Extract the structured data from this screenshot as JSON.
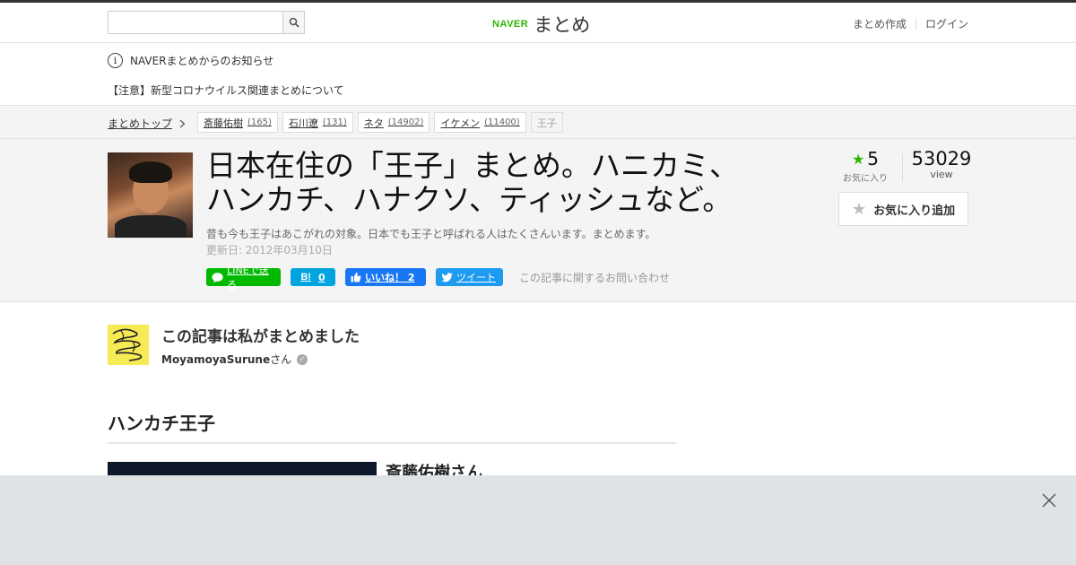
{
  "search": {
    "placeholder": ""
  },
  "logo": {
    "brand": "NAVER",
    "name": "まとめ"
  },
  "header": {
    "create_label": "まとめ作成",
    "login_label": "ログイン"
  },
  "notice": {
    "info_label": "NAVERまとめからのお知らせ",
    "message": "【注意】新型コロナウイルス関連まとめについて"
  },
  "breadcrumb": {
    "home_label": "まとめトップ",
    "tags": [
      {
        "label": "斎藤佑樹",
        "count": "(165)"
      },
      {
        "label": "石川遼",
        "count": "(131)"
      },
      {
        "label": "ネタ",
        "count": "(14902)"
      },
      {
        "label": "イケメン",
        "count": "(11400)"
      },
      {
        "label": "王子",
        "count": ""
      }
    ]
  },
  "article": {
    "title_line1": "日本在住の「王子」まとめ。ハニカミ、",
    "title_line2": "ハンカチ、ハナクソ、ティッシュなど。",
    "description": "昔も今も王子はあこがれの対象。日本でも王子と呼ばれる人はたくさんいます。まとめます。",
    "updated": "更新日: 2012年03月10日"
  },
  "share": {
    "line_label": "LINEで送る",
    "hatena_count": "0",
    "fb_label": "いいね！ 2",
    "tw_label": "ツイート",
    "inquiry_label": "この記事に関するお問い合わせ"
  },
  "stats": {
    "favorites": "5",
    "favorites_label": "お気に入り",
    "views": "53029",
    "views_label": "view",
    "fav_add_label": "お気に入り追加"
  },
  "author": {
    "heading": "この記事は私がまとめました",
    "name": "MoyamoyaSurune",
    "suffix": "さん"
  },
  "section": {
    "title": "ハンカチ王子",
    "first_item_title": "斎藤佑樹さん"
  },
  "colors": {
    "brand_green": "#2db400",
    "line_green": "#00b900",
    "hatena_blue": "#00a4de",
    "facebook_blue": "#1877f2",
    "twitter_blue": "#1d9bf0"
  }
}
